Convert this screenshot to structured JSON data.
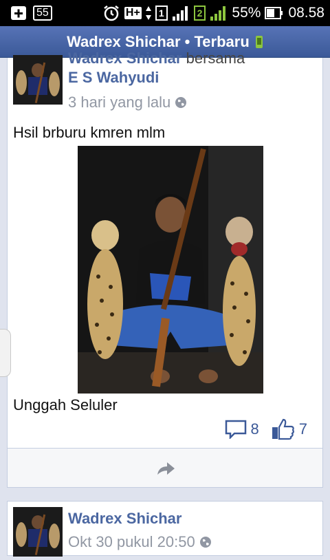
{
  "status_bar": {
    "sd_label": "55",
    "network_type": "H+",
    "sim1": "1",
    "sim2": "2",
    "battery_percent": "55%",
    "time": "08.58"
  },
  "header": {
    "title": "Wadrex Shichar • Terbaru"
  },
  "post1": {
    "author": "Wadrex Shichar",
    "with_word": "bersama",
    "tagged": "E S Wahyudi",
    "time": "3 hari yang lalu",
    "caption": "Hsil brburu kmren mlm",
    "source": "Unggah Seluler",
    "comment_count": "8",
    "like_count": "7"
  },
  "post2": {
    "author": "Wadrex Shichar",
    "time": "Okt 30 pukul 20:50"
  },
  "colors": {
    "header_blue": "#3b5998",
    "name_blue": "#4b67a1",
    "meta_gray": "#9197a3",
    "android_green": "#8dc63f"
  }
}
